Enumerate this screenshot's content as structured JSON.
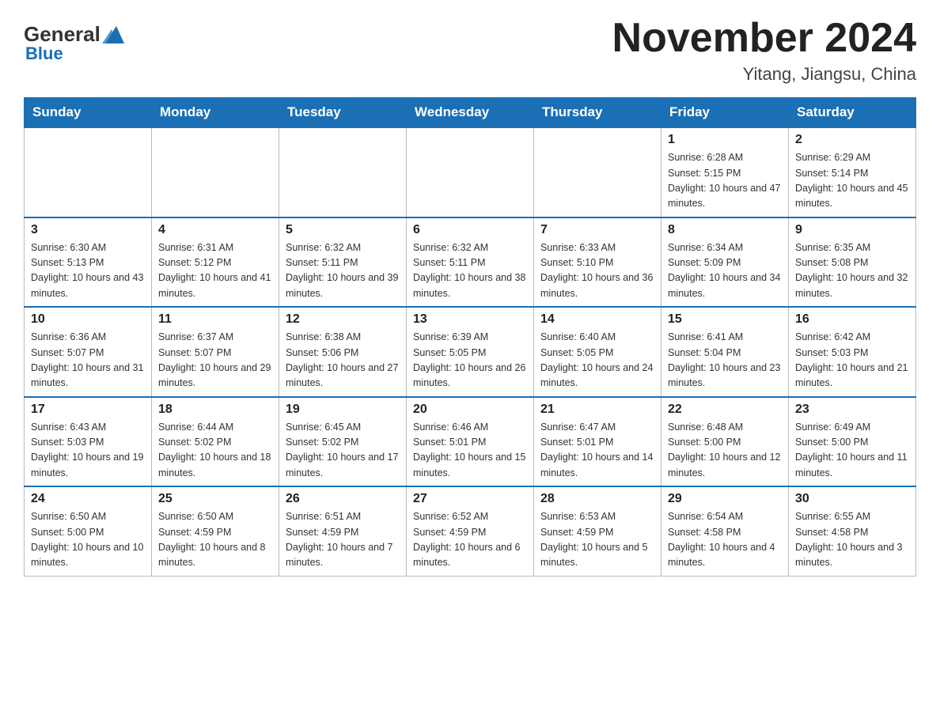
{
  "header": {
    "logo": {
      "general": "General",
      "blue": "Blue"
    },
    "title": "November 2024",
    "subtitle": "Yitang, Jiangsu, China"
  },
  "weekdays": [
    "Sunday",
    "Monday",
    "Tuesday",
    "Wednesday",
    "Thursday",
    "Friday",
    "Saturday"
  ],
  "weeks": [
    {
      "days": [
        {
          "number": "",
          "info": "",
          "empty": true
        },
        {
          "number": "",
          "info": "",
          "empty": true
        },
        {
          "number": "",
          "info": "",
          "empty": true
        },
        {
          "number": "",
          "info": "",
          "empty": true
        },
        {
          "number": "",
          "info": "",
          "empty": true
        },
        {
          "number": "1",
          "info": "Sunrise: 6:28 AM\nSunset: 5:15 PM\nDaylight: 10 hours and 47 minutes.",
          "empty": false
        },
        {
          "number": "2",
          "info": "Sunrise: 6:29 AM\nSunset: 5:14 PM\nDaylight: 10 hours and 45 minutes.",
          "empty": false
        }
      ]
    },
    {
      "days": [
        {
          "number": "3",
          "info": "Sunrise: 6:30 AM\nSunset: 5:13 PM\nDaylight: 10 hours and 43 minutes.",
          "empty": false
        },
        {
          "number": "4",
          "info": "Sunrise: 6:31 AM\nSunset: 5:12 PM\nDaylight: 10 hours and 41 minutes.",
          "empty": false
        },
        {
          "number": "5",
          "info": "Sunrise: 6:32 AM\nSunset: 5:11 PM\nDaylight: 10 hours and 39 minutes.",
          "empty": false
        },
        {
          "number": "6",
          "info": "Sunrise: 6:32 AM\nSunset: 5:11 PM\nDaylight: 10 hours and 38 minutes.",
          "empty": false
        },
        {
          "number": "7",
          "info": "Sunrise: 6:33 AM\nSunset: 5:10 PM\nDaylight: 10 hours and 36 minutes.",
          "empty": false
        },
        {
          "number": "8",
          "info": "Sunrise: 6:34 AM\nSunset: 5:09 PM\nDaylight: 10 hours and 34 minutes.",
          "empty": false
        },
        {
          "number": "9",
          "info": "Sunrise: 6:35 AM\nSunset: 5:08 PM\nDaylight: 10 hours and 32 minutes.",
          "empty": false
        }
      ]
    },
    {
      "days": [
        {
          "number": "10",
          "info": "Sunrise: 6:36 AM\nSunset: 5:07 PM\nDaylight: 10 hours and 31 minutes.",
          "empty": false
        },
        {
          "number": "11",
          "info": "Sunrise: 6:37 AM\nSunset: 5:07 PM\nDaylight: 10 hours and 29 minutes.",
          "empty": false
        },
        {
          "number": "12",
          "info": "Sunrise: 6:38 AM\nSunset: 5:06 PM\nDaylight: 10 hours and 27 minutes.",
          "empty": false
        },
        {
          "number": "13",
          "info": "Sunrise: 6:39 AM\nSunset: 5:05 PM\nDaylight: 10 hours and 26 minutes.",
          "empty": false
        },
        {
          "number": "14",
          "info": "Sunrise: 6:40 AM\nSunset: 5:05 PM\nDaylight: 10 hours and 24 minutes.",
          "empty": false
        },
        {
          "number": "15",
          "info": "Sunrise: 6:41 AM\nSunset: 5:04 PM\nDaylight: 10 hours and 23 minutes.",
          "empty": false
        },
        {
          "number": "16",
          "info": "Sunrise: 6:42 AM\nSunset: 5:03 PM\nDaylight: 10 hours and 21 minutes.",
          "empty": false
        }
      ]
    },
    {
      "days": [
        {
          "number": "17",
          "info": "Sunrise: 6:43 AM\nSunset: 5:03 PM\nDaylight: 10 hours and 19 minutes.",
          "empty": false
        },
        {
          "number": "18",
          "info": "Sunrise: 6:44 AM\nSunset: 5:02 PM\nDaylight: 10 hours and 18 minutes.",
          "empty": false
        },
        {
          "number": "19",
          "info": "Sunrise: 6:45 AM\nSunset: 5:02 PM\nDaylight: 10 hours and 17 minutes.",
          "empty": false
        },
        {
          "number": "20",
          "info": "Sunrise: 6:46 AM\nSunset: 5:01 PM\nDaylight: 10 hours and 15 minutes.",
          "empty": false
        },
        {
          "number": "21",
          "info": "Sunrise: 6:47 AM\nSunset: 5:01 PM\nDaylight: 10 hours and 14 minutes.",
          "empty": false
        },
        {
          "number": "22",
          "info": "Sunrise: 6:48 AM\nSunset: 5:00 PM\nDaylight: 10 hours and 12 minutes.",
          "empty": false
        },
        {
          "number": "23",
          "info": "Sunrise: 6:49 AM\nSunset: 5:00 PM\nDaylight: 10 hours and 11 minutes.",
          "empty": false
        }
      ]
    },
    {
      "days": [
        {
          "number": "24",
          "info": "Sunrise: 6:50 AM\nSunset: 5:00 PM\nDaylight: 10 hours and 10 minutes.",
          "empty": false
        },
        {
          "number": "25",
          "info": "Sunrise: 6:50 AM\nSunset: 4:59 PM\nDaylight: 10 hours and 8 minutes.",
          "empty": false
        },
        {
          "number": "26",
          "info": "Sunrise: 6:51 AM\nSunset: 4:59 PM\nDaylight: 10 hours and 7 minutes.",
          "empty": false
        },
        {
          "number": "27",
          "info": "Sunrise: 6:52 AM\nSunset: 4:59 PM\nDaylight: 10 hours and 6 minutes.",
          "empty": false
        },
        {
          "number": "28",
          "info": "Sunrise: 6:53 AM\nSunset: 4:59 PM\nDaylight: 10 hours and 5 minutes.",
          "empty": false
        },
        {
          "number": "29",
          "info": "Sunrise: 6:54 AM\nSunset: 4:58 PM\nDaylight: 10 hours and 4 minutes.",
          "empty": false
        },
        {
          "number": "30",
          "info": "Sunrise: 6:55 AM\nSunset: 4:58 PM\nDaylight: 10 hours and 3 minutes.",
          "empty": false
        }
      ]
    }
  ]
}
